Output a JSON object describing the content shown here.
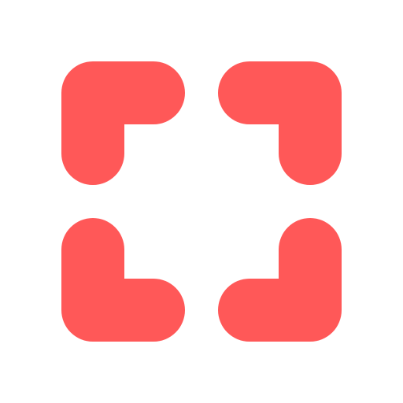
{
  "icon": {
    "name": "fullscreen-corners-icon",
    "color": "#FF5858",
    "background": "#FFFFFF",
    "corners": [
      {
        "name": "top-left-corner"
      },
      {
        "name": "top-right-corner"
      },
      {
        "name": "bottom-left-corner"
      },
      {
        "name": "bottom-right-corner"
      }
    ]
  }
}
